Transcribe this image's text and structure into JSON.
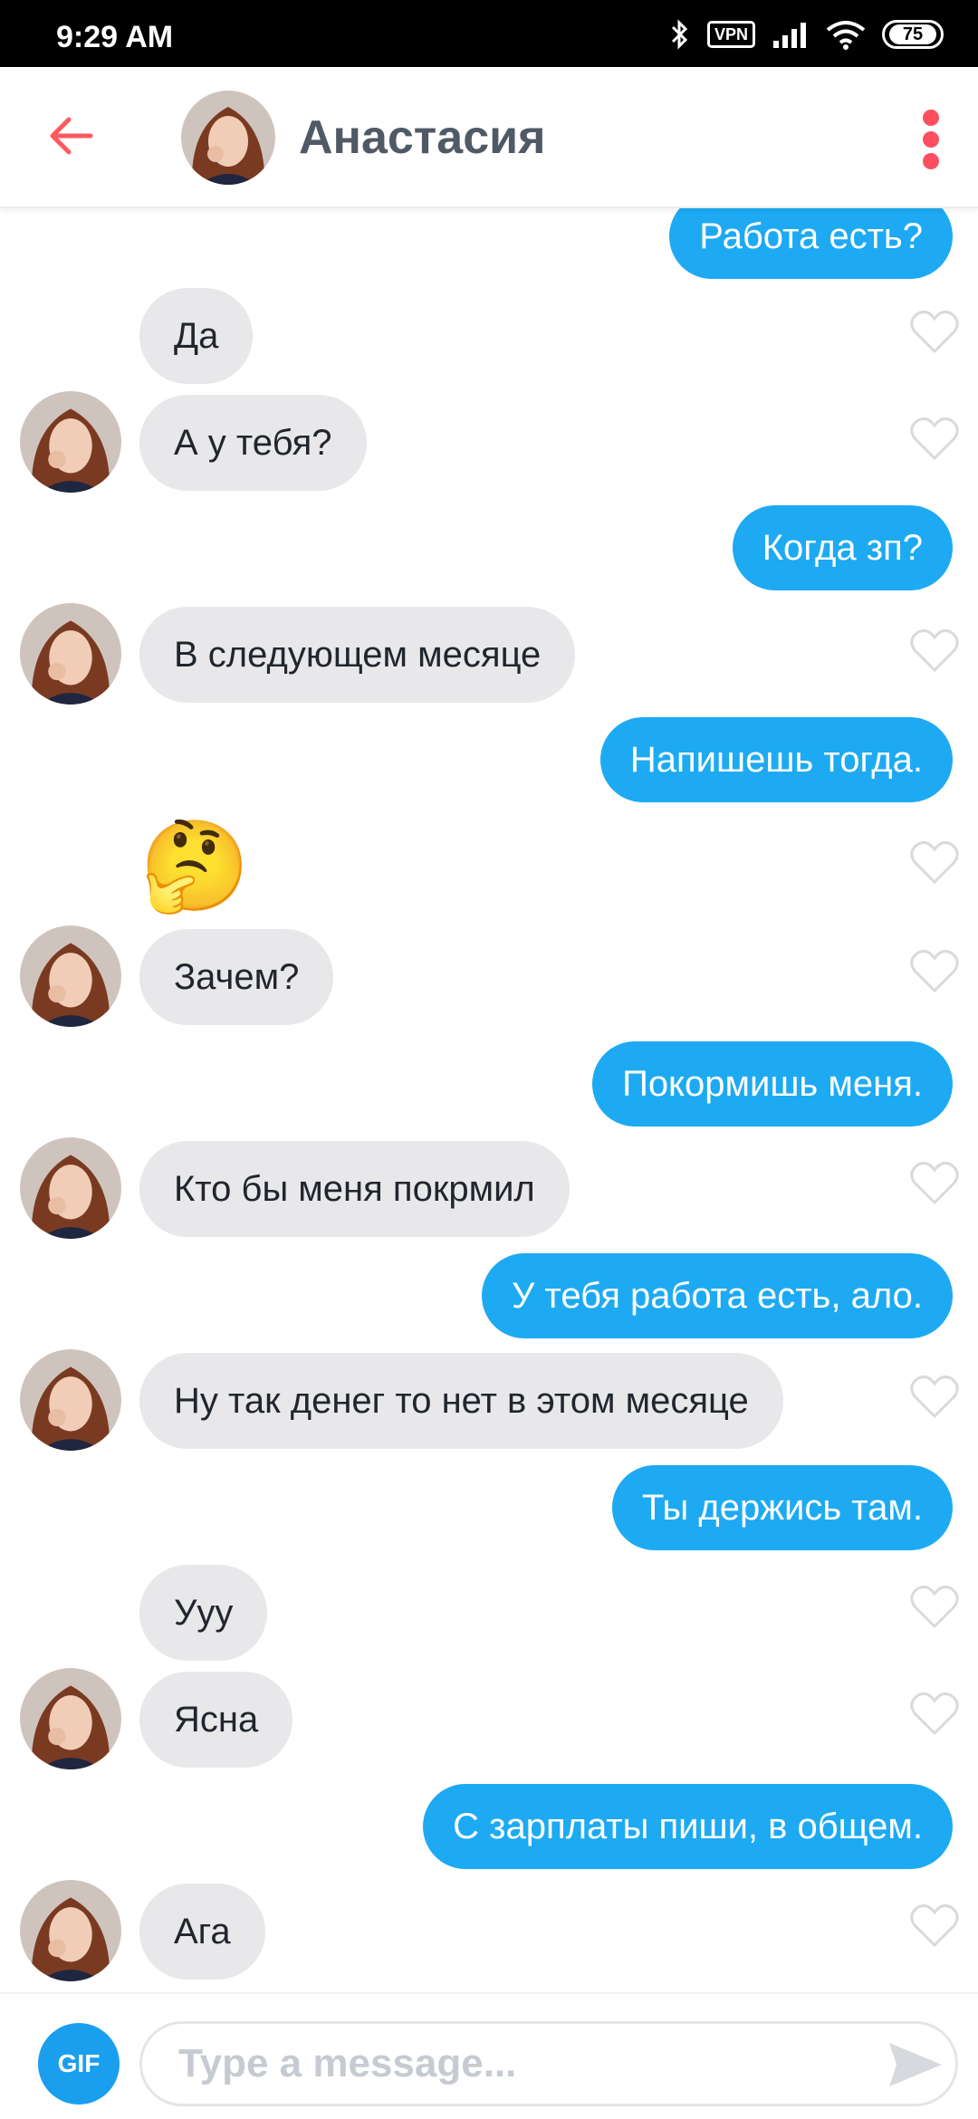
{
  "status": {
    "time": "9:29 AM",
    "vpn": "VPN",
    "battery": "75"
  },
  "header": {
    "name": "Анастасия"
  },
  "messages": [
    {
      "dir": "out",
      "text": "Работа есть?"
    },
    {
      "dir": "in",
      "text": "Да"
    },
    {
      "dir": "in",
      "text": "А у тебя?"
    },
    {
      "dir": "out",
      "text": "Когда зп?"
    },
    {
      "dir": "in",
      "text": "В следующем месяце"
    },
    {
      "dir": "out",
      "text": "Напишешь тогда."
    },
    {
      "dir": "in",
      "text": "🤔"
    },
    {
      "dir": "in",
      "text": "Зачем?"
    },
    {
      "dir": "out",
      "text": "Покормишь меня."
    },
    {
      "dir": "in",
      "text": "Кто бы меня покрмил"
    },
    {
      "dir": "out",
      "text": "У тебя работа есть, ало."
    },
    {
      "dir": "in",
      "text": "Ну так денег то нет в этом месяце"
    },
    {
      "dir": "out",
      "text": "Ты держись там."
    },
    {
      "dir": "in",
      "text": "Ууу"
    },
    {
      "dir": "in",
      "text": "Ясна"
    },
    {
      "dir": "out",
      "text": "С зарплаты пиши, в общем."
    },
    {
      "dir": "in",
      "text": "Ага"
    }
  ],
  "composer": {
    "gif_label": "GIF",
    "placeholder": "Type a message..."
  },
  "colors": {
    "accent": "#1daaf2",
    "incoming": "#e8e8ea",
    "brand": "#ff4f5e"
  }
}
